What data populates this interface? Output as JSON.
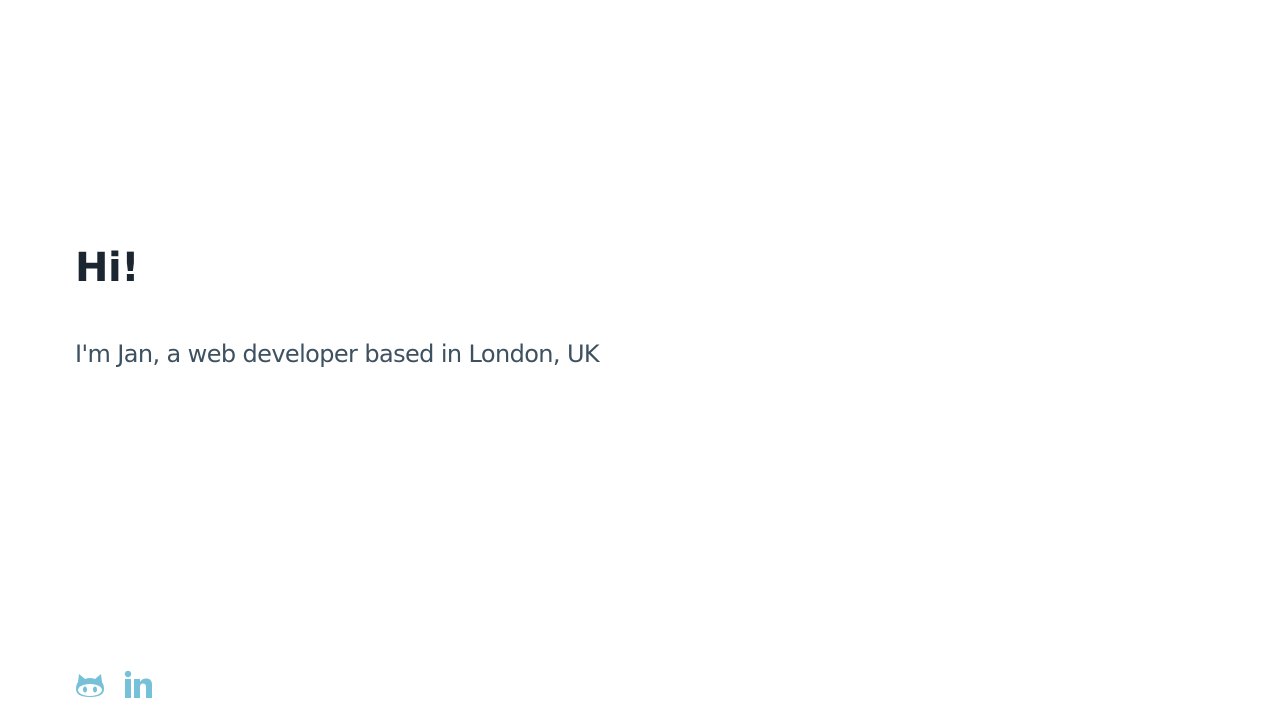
{
  "hero": {
    "title": "Hi!",
    "intro": "I'm Jan, a web developer based in London, UK"
  },
  "socials": [
    {
      "icon": "github-icon",
      "label": "GitHub"
    },
    {
      "icon": "linkedin-icon",
      "label": "LinkedIn"
    }
  ],
  "colors": {
    "title": "#1b2631",
    "text": "#3d5160",
    "icon": "#76c0d8",
    "background": "#ffffff"
  }
}
